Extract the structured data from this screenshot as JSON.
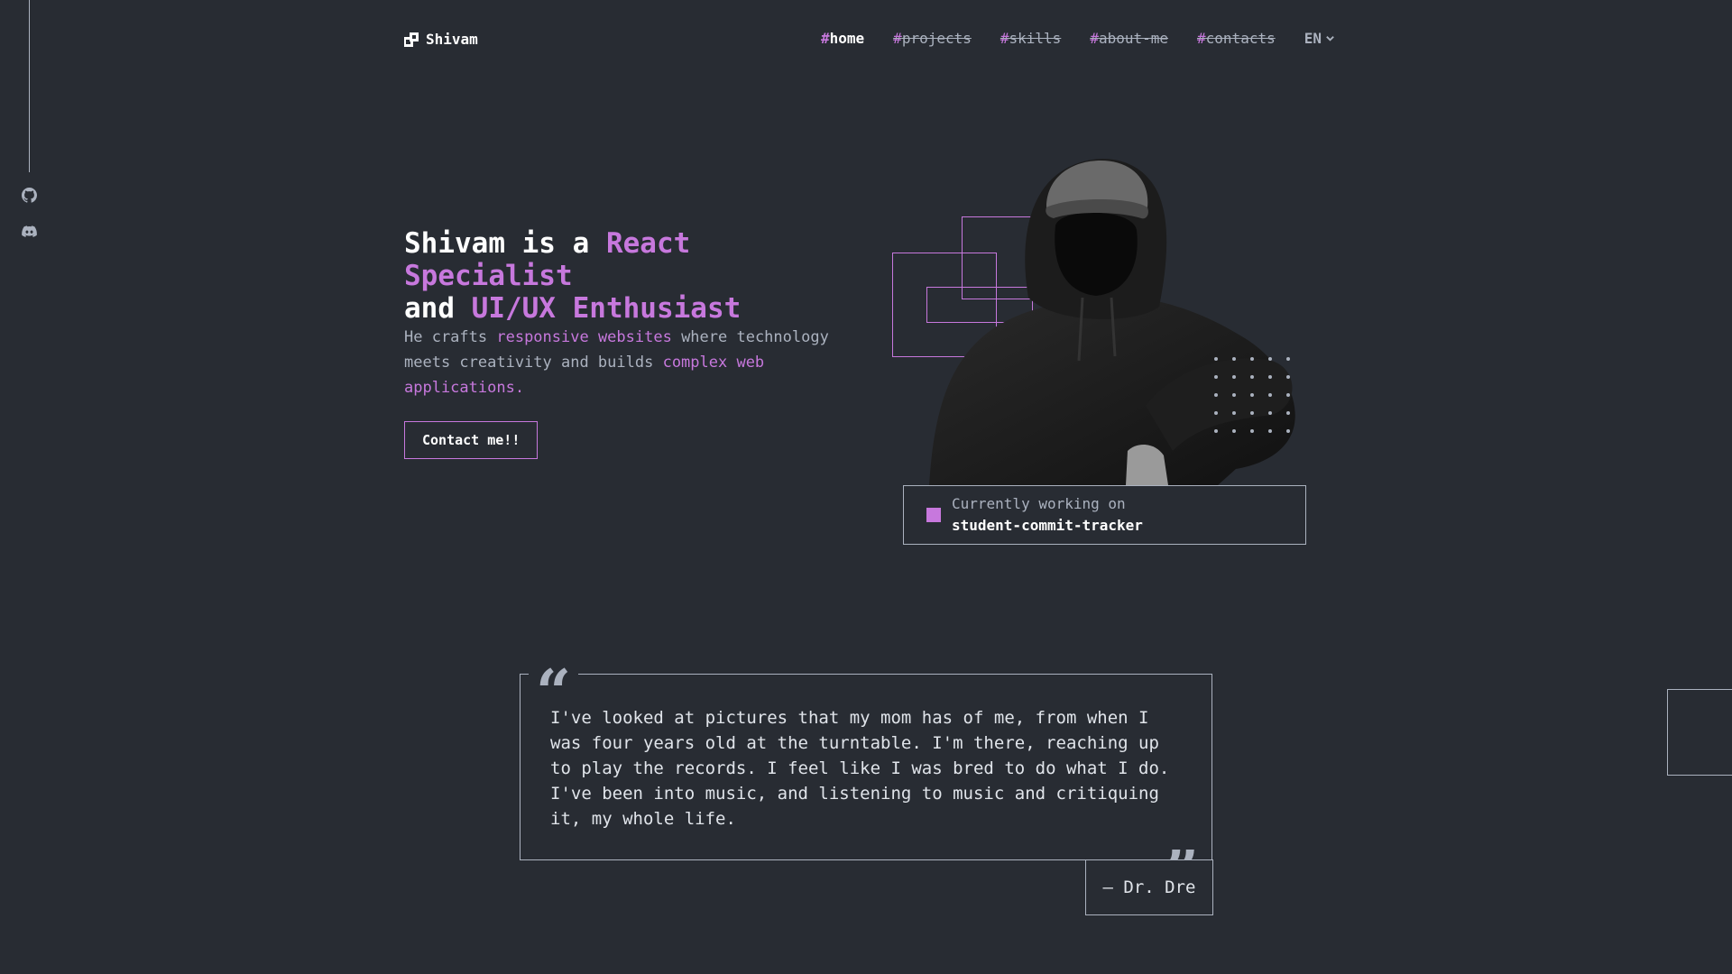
{
  "header": {
    "logo_text": "Shivam",
    "nav": [
      {
        "hash": "#",
        "label": "home",
        "active": true
      },
      {
        "hash": "#",
        "label": "projects",
        "active": false
      },
      {
        "hash": "#",
        "label": "skills",
        "active": false
      },
      {
        "hash": "#",
        "label": "about-me",
        "active": false
      },
      {
        "hash": "#",
        "label": "contacts",
        "active": false
      }
    ],
    "language": "EN"
  },
  "social": {
    "icons": [
      "github-icon",
      "discord-icon"
    ]
  },
  "hero": {
    "title_parts": [
      "Shivam is a ",
      "React Specialist",
      "and ",
      "UI/UX Enthusiast"
    ],
    "subtitle_parts": [
      "He crafts ",
      "responsive websites",
      " where technology meets creativity and builds ",
      "complex web applications."
    ],
    "cta_label": "Contact me!!",
    "working_label": "Currently working on",
    "working_project": "student-commit-tracker"
  },
  "quote": {
    "open_mark": "“",
    "close_mark": "”",
    "text": "I've looked at pictures that my mom has of me, from when I was four years old at the turntable. I'm there, reaching up to play the records. I feel like I was bred to do what I do. I've been into music, and listening to music and critiquing it, my whole life.",
    "author": "— Dr. Dre"
  },
  "colors": {
    "background": "#282c33",
    "accent": "#c778dd",
    "text": "#abb2bf"
  }
}
